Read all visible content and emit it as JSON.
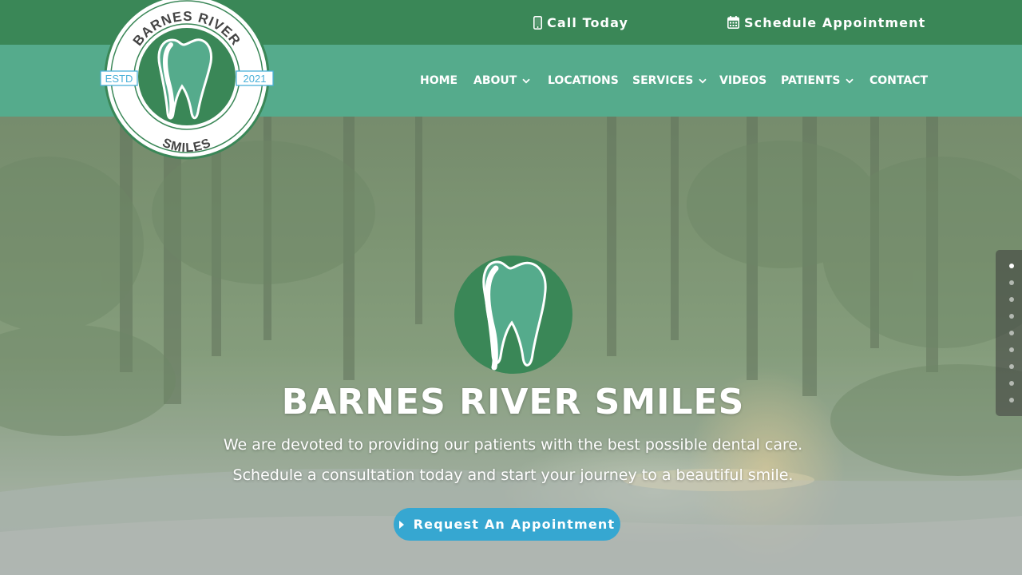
{
  "topbar": {
    "call": {
      "label": "Call Today",
      "icon": "phone-icon"
    },
    "schedule": {
      "label": "Schedule Appointment",
      "icon": "calendar-icon"
    }
  },
  "brand": {
    "name_top": "BARNES RIVER",
    "name_bottom": "SMILES",
    "estd_label": "ESTD",
    "estd_year": "2021"
  },
  "nav": {
    "items": [
      {
        "label": "HOME",
        "dropdown": false
      },
      {
        "label": "ABOUT",
        "dropdown": true
      },
      {
        "label": "LOCATIONS",
        "dropdown": false
      },
      {
        "label": "SERVICES",
        "dropdown": true
      },
      {
        "label": "VIDEOS",
        "dropdown": false
      },
      {
        "label": "PATIENTS",
        "dropdown": true
      },
      {
        "label": "CONTACT",
        "dropdown": false
      }
    ]
  },
  "hero": {
    "title": "BARNES RIVER SMILES",
    "line1": "We are devoted to providing our patients with the best possible dental care.",
    "line2": "Schedule a consultation today and start your journey to a beautiful smile.",
    "cta": "Request An Appointment",
    "cta_icon": "caret-right-icon"
  },
  "section_dots": {
    "count": 9,
    "active": 1
  },
  "colors": {
    "topbar": "#3a8757",
    "navbar": "#55ab8c",
    "logo_green": "#3a8757",
    "tooth": "#55ab8c",
    "cta": "#36a7d1",
    "estd_blue": "#4ab0d8"
  }
}
